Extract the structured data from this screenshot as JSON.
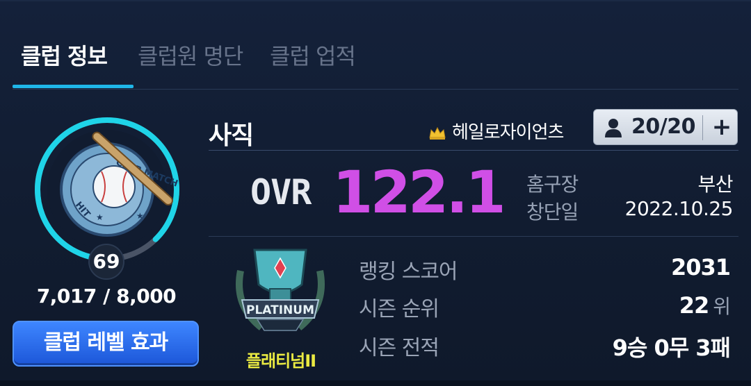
{
  "tabs": [
    {
      "label": "클럽 정보",
      "active": true
    },
    {
      "label": "클럽원 명단",
      "active": false
    },
    {
      "label": "클럽 업적",
      "active": false
    }
  ],
  "club": {
    "level": "69",
    "exp": "7,017 / 8,000",
    "exp_progress": 0.877,
    "level_button": "클럽 레벨 효과",
    "name": "사직",
    "owner": "헤일로자이언츠",
    "members": "20/20",
    "ovr_label": "OVR",
    "ovr_value": "122.1"
  },
  "info": {
    "home_label": "홈구장",
    "home_value": "부산",
    "founded_label": "창단일",
    "founded_value": "2022.10.25"
  },
  "tier": {
    "name": "플래티넘II",
    "emblem_text": "PLATINUM"
  },
  "ranking": [
    {
      "label": "랭킹 스코어",
      "value": "2031",
      "unit": ""
    },
    {
      "label": "시즌 순위",
      "value": "22",
      "unit": "위"
    },
    {
      "label": "시즌 전적",
      "value": "9승 0무 3패",
      "unit": ""
    }
  ],
  "colors": {
    "accent": "#1fb6e8",
    "ovr": "#d04fe6",
    "tier": "#eaea42",
    "button": "#2a6cf0"
  }
}
